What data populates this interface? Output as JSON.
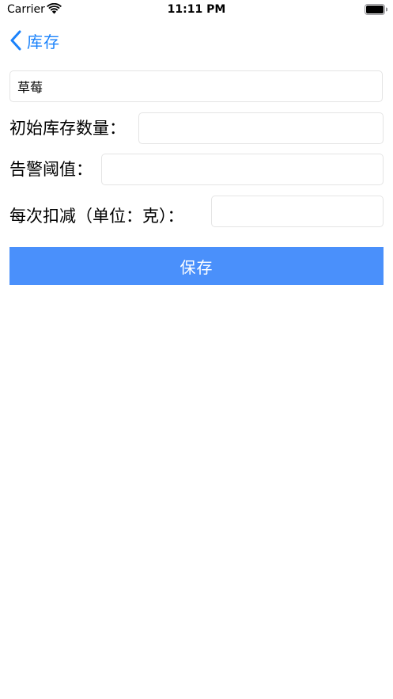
{
  "status_bar": {
    "carrier": "Carrier",
    "time": "11:11 PM",
    "icons": [
      "wifi-icon",
      "battery-icon"
    ]
  },
  "nav": {
    "back_label": "库存",
    "back_icon": "chevron-left-icon",
    "accent_color": "#1a82fb"
  },
  "form": {
    "name_value": "草莓",
    "initial_stock_label": "初始库存数量：",
    "initial_stock_value": "",
    "alert_threshold_label": "告警阈值：",
    "alert_threshold_value": "",
    "deduct_per_time_label": "每次扣减（单位：克）：",
    "deduct_per_time_value": ""
  },
  "actions": {
    "save_label": "保存",
    "save_color": "#4a90fb"
  }
}
